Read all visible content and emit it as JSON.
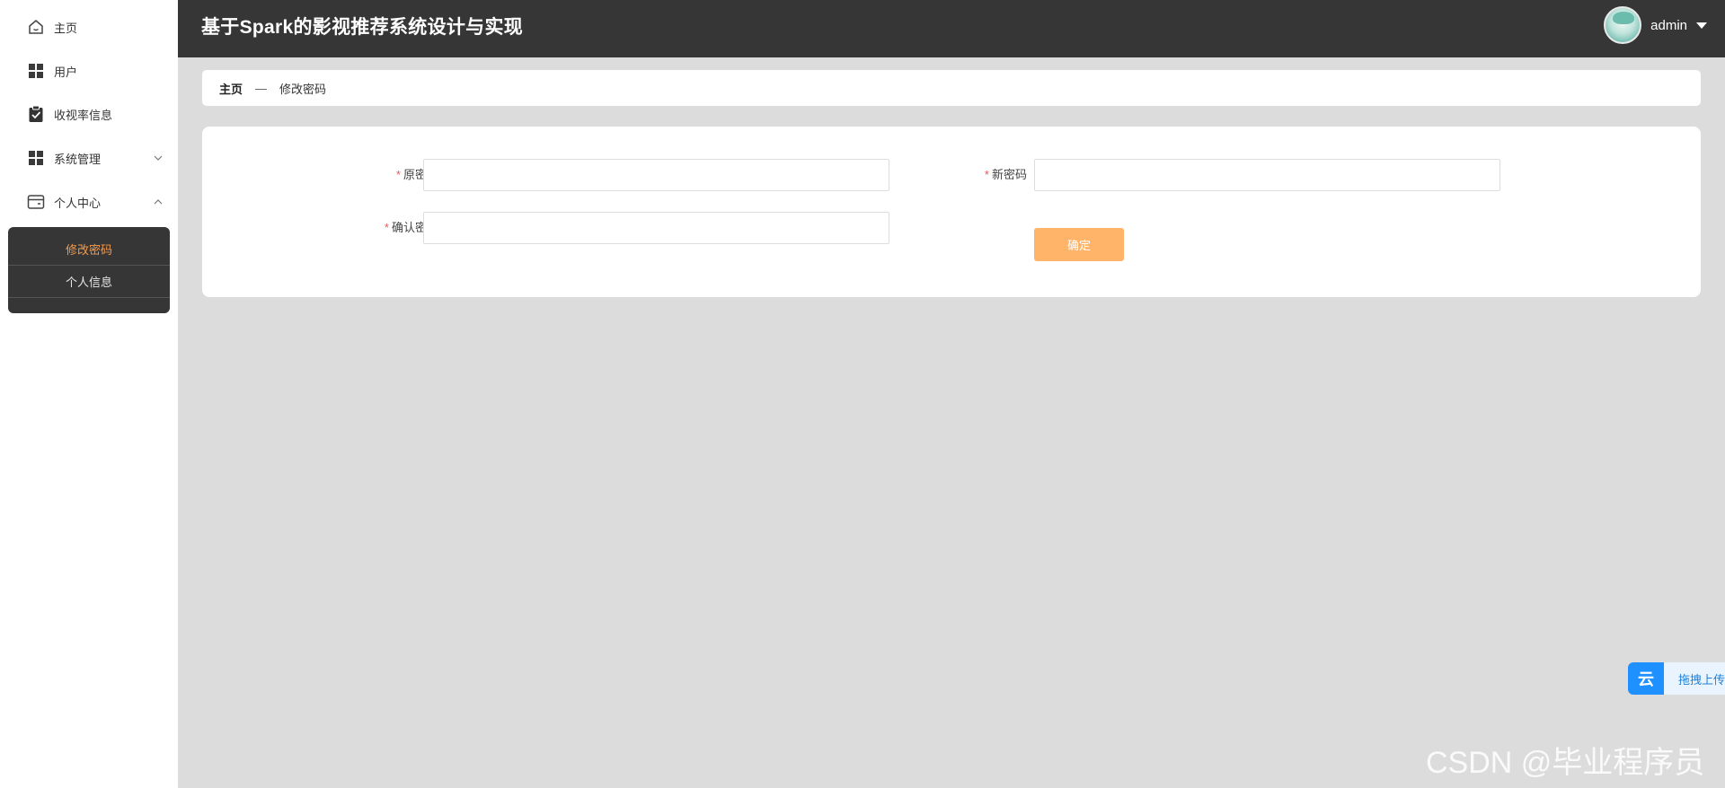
{
  "sidebar": {
    "items": [
      {
        "label": "主页",
        "icon": "home-icon"
      },
      {
        "label": "用户",
        "icon": "grid-icon"
      },
      {
        "label": "收视率信息",
        "icon": "clipboard-check-icon"
      },
      {
        "label": "系统管理",
        "icon": "grid-icon",
        "arrow": "chevron-down-icon"
      },
      {
        "label": "个人中心",
        "icon": "wallet-icon",
        "arrow": "chevron-up-icon"
      }
    ],
    "submenu": [
      {
        "label": "修改密码",
        "active": true
      },
      {
        "label": "个人信息",
        "active": false
      }
    ]
  },
  "header": {
    "title": "基于Spark的影视推荐系统设计与实现",
    "username": "admin"
  },
  "breadcrumb": {
    "home": "主页",
    "separator": "—",
    "current": "修改密码"
  },
  "form": {
    "old_password_label": "原密码",
    "new_password_label": "新密码",
    "confirm_password_label": "确认密码",
    "required_mark": "*",
    "old_password_value": "",
    "new_password_value": "",
    "confirm_password_value": "",
    "submit_label": "确定"
  },
  "widget": {
    "icon_glyph": "云",
    "label": "拖拽上传"
  },
  "watermark": "CSDN @毕业程序员",
  "colors": {
    "header_bg": "#363636",
    "active_submenu": "#f29b4e",
    "confirm_button": "#ffb46a",
    "required": "#e65b5b"
  }
}
